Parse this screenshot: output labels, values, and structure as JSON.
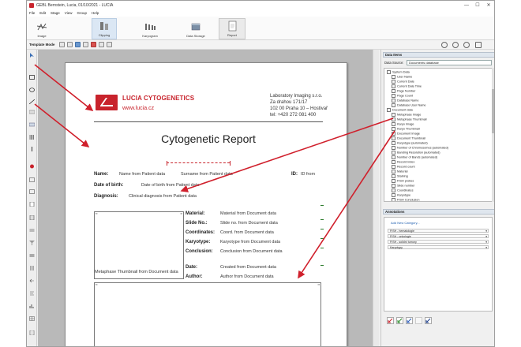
{
  "window": {
    "title": "GEBL Bernstein, Lucia, 01/10/2021 - LUCIA",
    "controls": [
      "—",
      "☐",
      "✕"
    ]
  },
  "menu": [
    "File",
    "Edit",
    "Stage",
    "View",
    "Group",
    "Help"
  ],
  "ribbon": {
    "tabs": [
      {
        "label": "Image"
      },
      {
        "label": "Clipping"
      },
      {
        "label": "Karyogram"
      },
      {
        "label": "Data Storage"
      },
      {
        "label": "Report"
      }
    ]
  },
  "template_toolbar": {
    "label": "Template Mode"
  },
  "report": {
    "brand": "LUCIA CYTOGENETICS",
    "brand_url": "www.lucia.cz",
    "lab_lines": [
      "Laboratory Imaging s.r.o.",
      "Za drahou 171/17",
      "102 00 Praha 10 – Hostivař",
      "tel: +420 272 081 400"
    ],
    "title": "Cytogenetic Report",
    "name_label": "Name:",
    "name_value": "Name from Patient data",
    "surname_value": "Surname from Patient data",
    "id_label": "ID:",
    "id_value": "ID from",
    "dob_label": "Date of birth:",
    "dob_value": "Date of birth from Patient data",
    "diag_label": "Diagnosis:",
    "diag_value": "Clinical diagnosis from Patient data",
    "fields": [
      {
        "label": "Material:",
        "value": "Material from Document data"
      },
      {
        "label": "Slide No.:",
        "value": "Slide no. from Document data"
      },
      {
        "label": "Coordinates:",
        "value": "Coord. from Document data"
      },
      {
        "label": "Karyotype:",
        "value": "Karyotype from Document data"
      },
      {
        "label": "Conclusion:",
        "value": "Conclusion from Document data"
      }
    ],
    "date_label": "Date:",
    "date_value": "Created from Document data",
    "author_label": "Author:",
    "author_value": "Author from Document data",
    "metaphase_caption": "Metaphase Thumbnail from Document data",
    "box_tag": "▪▪"
  },
  "data_items": {
    "header": "Data Items",
    "source_label": "Data Source:",
    "source_value": "Documents database",
    "tree": [
      {
        "label": "System Data",
        "indent": 0
      },
      {
        "label": "User Name",
        "indent": 2
      },
      {
        "label": "Current Date",
        "indent": 2
      },
      {
        "label": "Current Date Time",
        "indent": 2
      },
      {
        "label": "Page Number",
        "indent": 2
      },
      {
        "label": "Page Count",
        "indent": 2
      },
      {
        "label": "Database Name",
        "indent": 2
      },
      {
        "label": "Database User Name",
        "indent": 2
      },
      {
        "label": "Document data",
        "indent": 0
      },
      {
        "label": "Metaphase Image",
        "indent": 2
      },
      {
        "label": "Metaphase Thumbnail",
        "indent": 2
      },
      {
        "label": "Karyo Image",
        "indent": 2
      },
      {
        "label": "Karyo Thumbnail",
        "indent": 2
      },
      {
        "label": "Document Image",
        "indent": 2
      },
      {
        "label": "Document Thumbnail",
        "indent": 2
      },
      {
        "label": "Karyotype (automated)",
        "indent": 2
      },
      {
        "label": "Number of Chromosomes (automated)",
        "indent": 2
      },
      {
        "label": "Banding Resolution (automated)",
        "indent": 2
      },
      {
        "label": "Number of Bands (automated)",
        "indent": 2
      },
      {
        "label": "Record index",
        "indent": 2
      },
      {
        "label": "Record count",
        "indent": 2
      },
      {
        "label": "Material",
        "indent": 2
      },
      {
        "label": "Staining",
        "indent": 2
      },
      {
        "label": "FISH probes",
        "indent": 2
      },
      {
        "label": "Slide number",
        "indent": 2
      },
      {
        "label": "Coordinates",
        "indent": 2
      },
      {
        "label": "Karyotype",
        "indent": 2
      },
      {
        "label": "FISH Conclusion",
        "indent": 2
      }
    ]
  },
  "annotations": {
    "header": "Annotations",
    "add_link": "Add New Category...",
    "categories": [
      "FISH - hematologie",
      "FISH - onkologie",
      "FISH - solidní tumory",
      "Karyotypy"
    ]
  },
  "colors": {
    "brand": "#c8232c",
    "arrow": "#d0202c"
  }
}
